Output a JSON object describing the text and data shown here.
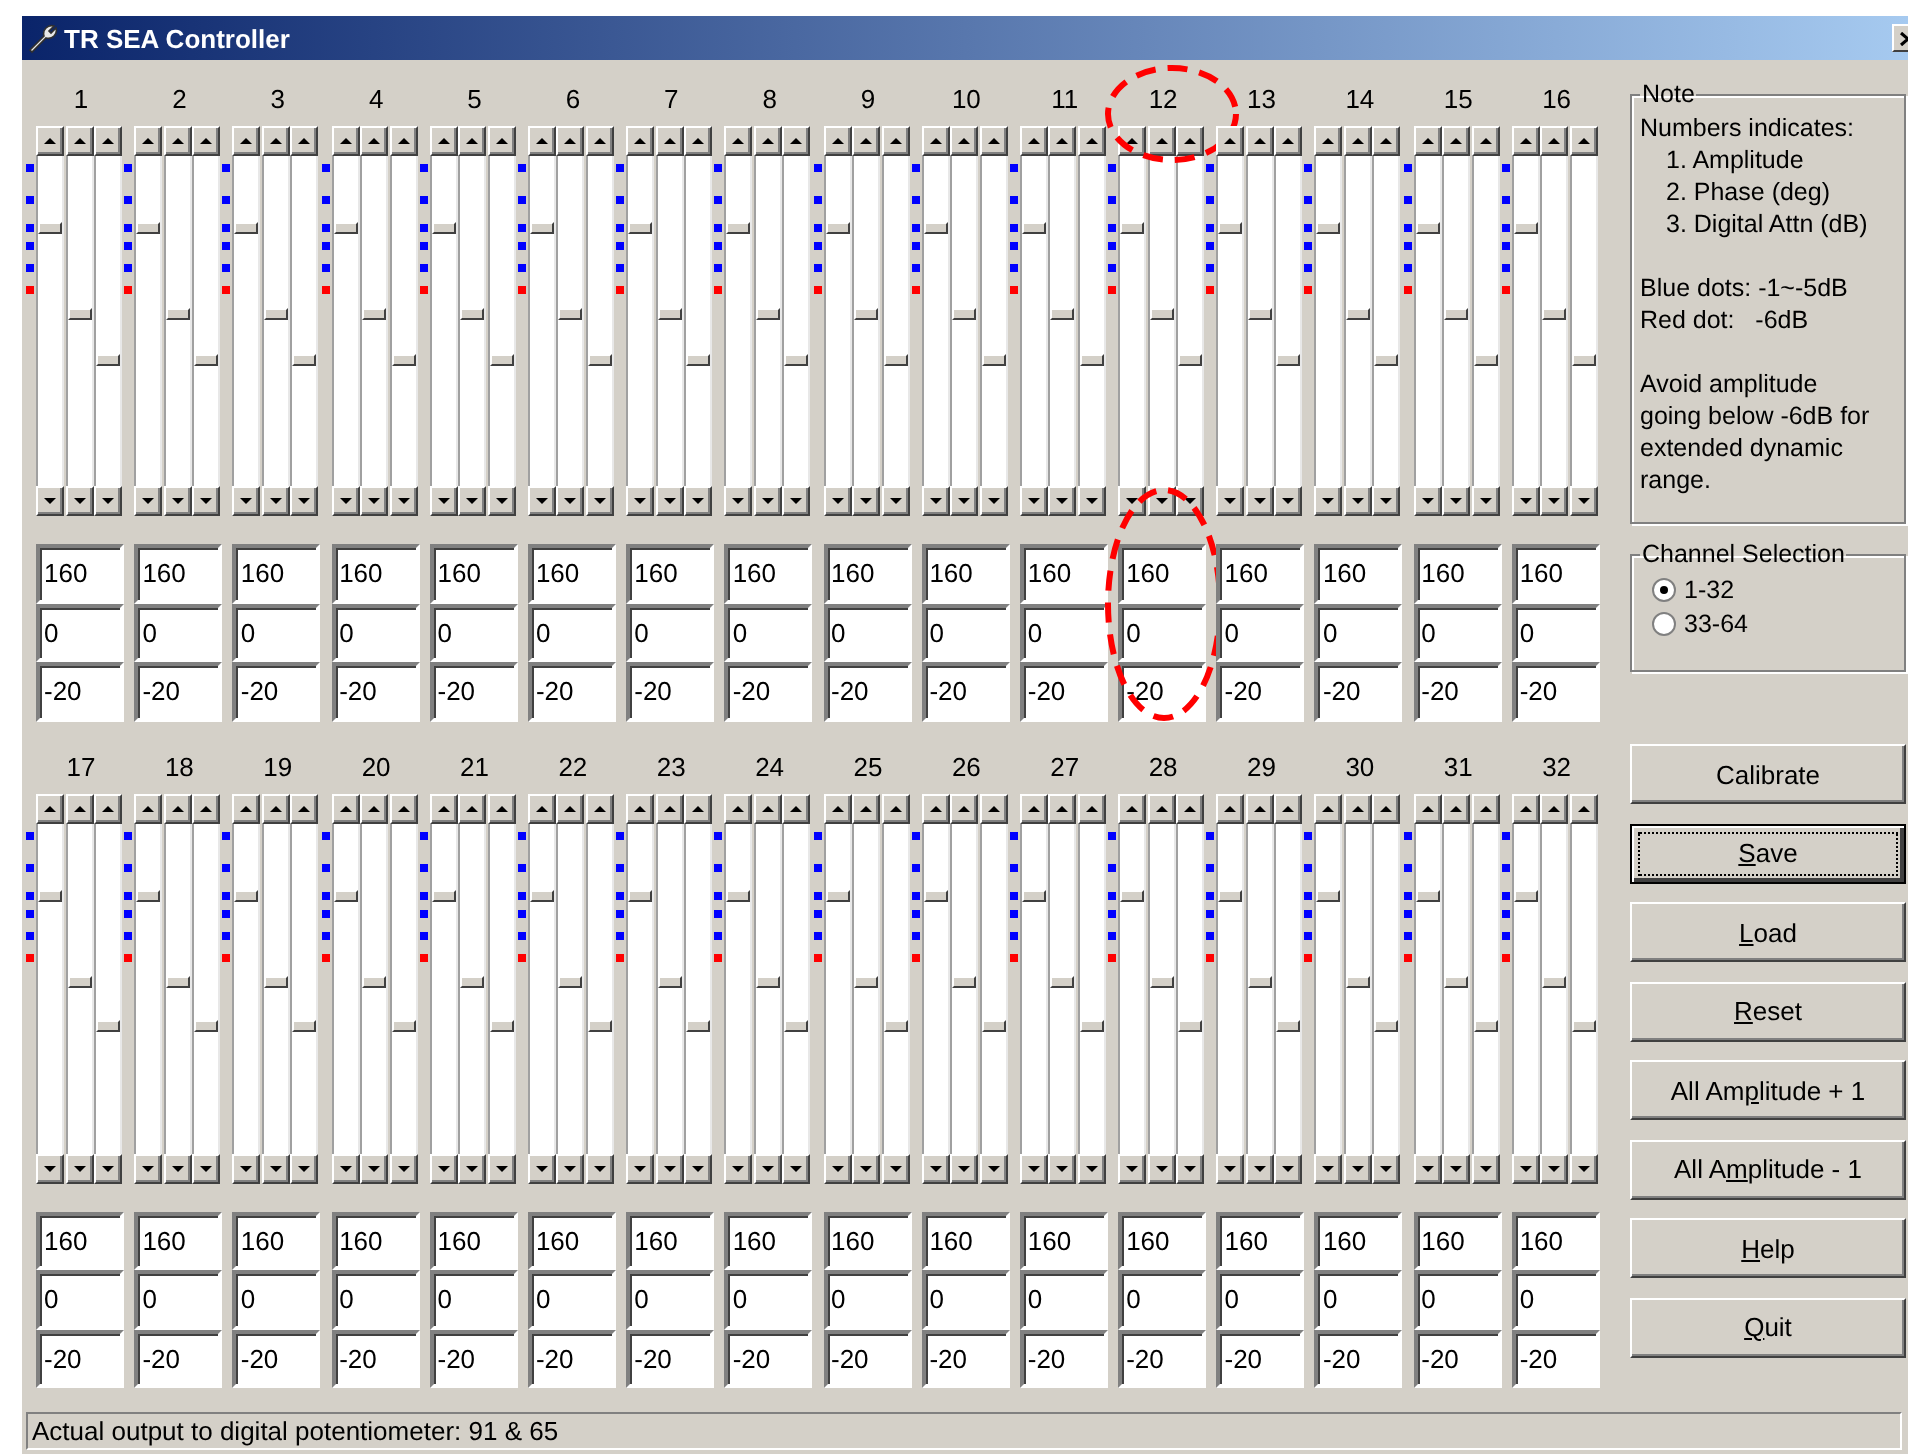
{
  "window": {
    "title": "TR SEA Controller"
  },
  "groups": [
    {
      "channels": [
        {
          "label": "1",
          "amplitude": {
            "value": "160",
            "level": 0.79
          },
          "phase": {
            "value": "0",
            "level": 0.52
          },
          "attenuation": {
            "value": "-20",
            "level": 0.38
          },
          "circled_header": false,
          "circled_fields": false
        },
        {
          "label": "2",
          "amplitude": {
            "value": "160",
            "level": 0.79
          },
          "phase": {
            "value": "0",
            "level": 0.52
          },
          "attenuation": {
            "value": "-20",
            "level": 0.38
          },
          "circled_header": false,
          "circled_fields": false
        },
        {
          "label": "3",
          "amplitude": {
            "value": "160",
            "level": 0.79
          },
          "phase": {
            "value": "0",
            "level": 0.52
          },
          "attenuation": {
            "value": "-20",
            "level": 0.38
          },
          "circled_header": false,
          "circled_fields": false
        },
        {
          "label": "4",
          "amplitude": {
            "value": "160",
            "level": 0.79
          },
          "phase": {
            "value": "0",
            "level": 0.52
          },
          "attenuation": {
            "value": "-20",
            "level": 0.38
          },
          "circled_header": false,
          "circled_fields": false
        },
        {
          "label": "5",
          "amplitude": {
            "value": "160",
            "level": 0.79
          },
          "phase": {
            "value": "0",
            "level": 0.52
          },
          "attenuation": {
            "value": "-20",
            "level": 0.38
          },
          "circled_header": false,
          "circled_fields": false
        },
        {
          "label": "6",
          "amplitude": {
            "value": "160",
            "level": 0.79
          },
          "phase": {
            "value": "0",
            "level": 0.52
          },
          "attenuation": {
            "value": "-20",
            "level": 0.38
          },
          "circled_header": false,
          "circled_fields": false
        },
        {
          "label": "7",
          "amplitude": {
            "value": "160",
            "level": 0.79
          },
          "phase": {
            "value": "0",
            "level": 0.52
          },
          "attenuation": {
            "value": "-20",
            "level": 0.38
          },
          "circled_header": false,
          "circled_fields": false
        },
        {
          "label": "8",
          "amplitude": {
            "value": "160",
            "level": 0.79
          },
          "phase": {
            "value": "0",
            "level": 0.52
          },
          "attenuation": {
            "value": "-20",
            "level": 0.38
          },
          "circled_header": false,
          "circled_fields": false
        },
        {
          "label": "9",
          "amplitude": {
            "value": "160",
            "level": 0.79
          },
          "phase": {
            "value": "0",
            "level": 0.52
          },
          "attenuation": {
            "value": "-20",
            "level": 0.38
          },
          "circled_header": false,
          "circled_fields": false
        },
        {
          "label": "10",
          "amplitude": {
            "value": "160",
            "level": 0.79
          },
          "phase": {
            "value": "0",
            "level": 0.52
          },
          "attenuation": {
            "value": "-20",
            "level": 0.38
          },
          "circled_header": false,
          "circled_fields": false
        },
        {
          "label": "11",
          "amplitude": {
            "value": "160",
            "level": 0.79
          },
          "phase": {
            "value": "0",
            "level": 0.52
          },
          "attenuation": {
            "value": "-20",
            "level": 0.38
          },
          "circled_header": false,
          "circled_fields": false
        },
        {
          "label": "12",
          "amplitude": {
            "value": "160",
            "level": 0.79
          },
          "phase": {
            "value": "0",
            "level": 0.52
          },
          "attenuation": {
            "value": "-20",
            "level": 0.38
          },
          "circled_header": true,
          "circled_fields": true
        },
        {
          "label": "13",
          "amplitude": {
            "value": "160",
            "level": 0.79
          },
          "phase": {
            "value": "0",
            "level": 0.52
          },
          "attenuation": {
            "value": "-20",
            "level": 0.38
          },
          "circled_header": false,
          "circled_fields": false
        },
        {
          "label": "14",
          "amplitude": {
            "value": "160",
            "level": 0.79
          },
          "phase": {
            "value": "0",
            "level": 0.52
          },
          "attenuation": {
            "value": "-20",
            "level": 0.38
          },
          "circled_header": false,
          "circled_fields": false
        },
        {
          "label": "15",
          "amplitude": {
            "value": "160",
            "level": 0.79
          },
          "phase": {
            "value": "0",
            "level": 0.52
          },
          "attenuation": {
            "value": "-20",
            "level": 0.38
          },
          "circled_header": false,
          "circled_fields": false
        },
        {
          "label": "16",
          "amplitude": {
            "value": "160",
            "level": 0.79
          },
          "phase": {
            "value": "0",
            "level": 0.52
          },
          "attenuation": {
            "value": "-20",
            "level": 0.38
          },
          "circled_header": false,
          "circled_fields": false
        }
      ]
    },
    {
      "channels": [
        {
          "label": "17",
          "amplitude": {
            "value": "160",
            "level": 0.79
          },
          "phase": {
            "value": "0",
            "level": 0.52
          },
          "attenuation": {
            "value": "-20",
            "level": 0.38
          },
          "circled_header": false,
          "circled_fields": false
        },
        {
          "label": "18",
          "amplitude": {
            "value": "160",
            "level": 0.79
          },
          "phase": {
            "value": "0",
            "level": 0.52
          },
          "attenuation": {
            "value": "-20",
            "level": 0.38
          },
          "circled_header": false,
          "circled_fields": false
        },
        {
          "label": "19",
          "amplitude": {
            "value": "160",
            "level": 0.79
          },
          "phase": {
            "value": "0",
            "level": 0.52
          },
          "attenuation": {
            "value": "-20",
            "level": 0.38
          },
          "circled_header": false,
          "circled_fields": false
        },
        {
          "label": "20",
          "amplitude": {
            "value": "160",
            "level": 0.79
          },
          "phase": {
            "value": "0",
            "level": 0.52
          },
          "attenuation": {
            "value": "-20",
            "level": 0.38
          },
          "circled_header": false,
          "circled_fields": false
        },
        {
          "label": "21",
          "amplitude": {
            "value": "160",
            "level": 0.79
          },
          "phase": {
            "value": "0",
            "level": 0.52
          },
          "attenuation": {
            "value": "-20",
            "level": 0.38
          },
          "circled_header": false,
          "circled_fields": false
        },
        {
          "label": "22",
          "amplitude": {
            "value": "160",
            "level": 0.79
          },
          "phase": {
            "value": "0",
            "level": 0.52
          },
          "attenuation": {
            "value": "-20",
            "level": 0.38
          },
          "circled_header": false,
          "circled_fields": false
        },
        {
          "label": "23",
          "amplitude": {
            "value": "160",
            "level": 0.79
          },
          "phase": {
            "value": "0",
            "level": 0.52
          },
          "attenuation": {
            "value": "-20",
            "level": 0.38
          },
          "circled_header": false,
          "circled_fields": false
        },
        {
          "label": "24",
          "amplitude": {
            "value": "160",
            "level": 0.79
          },
          "phase": {
            "value": "0",
            "level": 0.52
          },
          "attenuation": {
            "value": "-20",
            "level": 0.38
          },
          "circled_header": false,
          "circled_fields": false
        },
        {
          "label": "25",
          "amplitude": {
            "value": "160",
            "level": 0.79
          },
          "phase": {
            "value": "0",
            "level": 0.52
          },
          "attenuation": {
            "value": "-20",
            "level": 0.38
          },
          "circled_header": false,
          "circled_fields": false
        },
        {
          "label": "26",
          "amplitude": {
            "value": "160",
            "level": 0.79
          },
          "phase": {
            "value": "0",
            "level": 0.52
          },
          "attenuation": {
            "value": "-20",
            "level": 0.38
          },
          "circled_header": false,
          "circled_fields": false
        },
        {
          "label": "27",
          "amplitude": {
            "value": "160",
            "level": 0.79
          },
          "phase": {
            "value": "0",
            "level": 0.52
          },
          "attenuation": {
            "value": "-20",
            "level": 0.38
          },
          "circled_header": false,
          "circled_fields": false
        },
        {
          "label": "28",
          "amplitude": {
            "value": "160",
            "level": 0.79
          },
          "phase": {
            "value": "0",
            "level": 0.52
          },
          "attenuation": {
            "value": "-20",
            "level": 0.38
          },
          "circled_header": false,
          "circled_fields": false
        },
        {
          "label": "29",
          "amplitude": {
            "value": "160",
            "level": 0.79
          },
          "phase": {
            "value": "0",
            "level": 0.52
          },
          "attenuation": {
            "value": "-20",
            "level": 0.38
          },
          "circled_header": false,
          "circled_fields": false
        },
        {
          "label": "30",
          "amplitude": {
            "value": "160",
            "level": 0.79
          },
          "phase": {
            "value": "0",
            "level": 0.52
          },
          "attenuation": {
            "value": "-20",
            "level": 0.38
          },
          "circled_header": false,
          "circled_fields": false
        },
        {
          "label": "31",
          "amplitude": {
            "value": "160",
            "level": 0.79
          },
          "phase": {
            "value": "0",
            "level": 0.52
          },
          "attenuation": {
            "value": "-20",
            "level": 0.38
          },
          "circled_header": false,
          "circled_fields": false
        },
        {
          "label": "32",
          "amplitude": {
            "value": "160",
            "level": 0.79
          },
          "phase": {
            "value": "0",
            "level": 0.52
          },
          "attenuation": {
            "value": "-20",
            "level": 0.38
          },
          "circled_header": false,
          "circled_fields": false
        }
      ]
    }
  ],
  "note": {
    "title": "Note",
    "heading": "Numbers indicates:",
    "items": [
      "1. Amplitude",
      "2. Phase (deg)",
      "3. Digital Attn (dB)"
    ],
    "legend": [
      "Blue dots: -1~-5dB",
      "Red dot:   -6dB"
    ],
    "warning": "Avoid amplitude going below -6dB for extended dynamic range."
  },
  "channel_selection": {
    "title": "Channel Selection",
    "options": [
      {
        "label": "1-32",
        "selected": true
      },
      {
        "label": "33-64",
        "selected": false
      }
    ]
  },
  "buttons": [
    {
      "label": "Calibrate",
      "focused": false
    },
    {
      "access_key": "S",
      "after": "ave",
      "focused": true
    },
    {
      "access_key": "L",
      "after": "oad",
      "focused": false
    },
    {
      "access_key": "R",
      "after": "eset",
      "focused": false
    },
    {
      "before": "All Am",
      "access_key": "p",
      "after": "litude + 1",
      "focused": false
    },
    {
      "before": "All A",
      "access_key": "m",
      "after": "plitude - 1",
      "focused": false
    },
    {
      "access_key": "H",
      "after": "elp",
      "focused": false
    },
    {
      "access_key": "Q",
      "after": "uit",
      "focused": false
    }
  ],
  "status_bar": "Actual output to digital potentiometer: 91 & 65"
}
